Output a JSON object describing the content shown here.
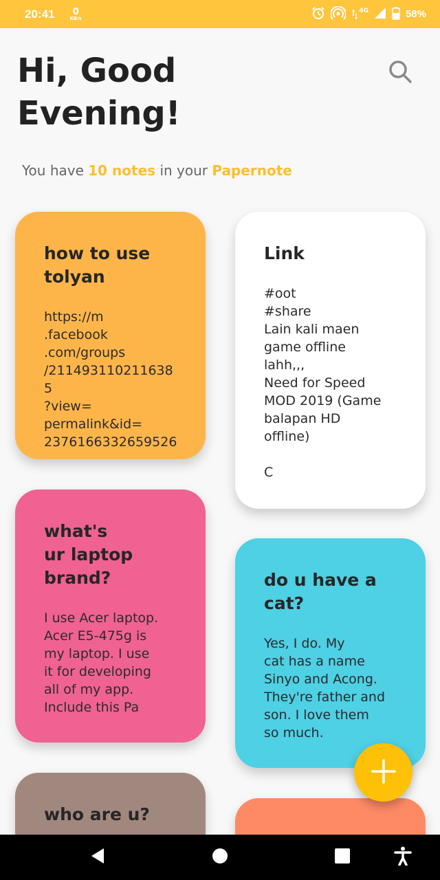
{
  "status_bar": {
    "time": "20:41",
    "net_speed_value": "0",
    "net_speed_unit": "KB/s",
    "network_type": "4G",
    "battery": "58%",
    "icons": [
      "alarm-icon",
      "hotspot-icon",
      "data-arrows-icon",
      "signal-icon",
      "battery-icon"
    ]
  },
  "header": {
    "greeting_line1": "Hi, Good",
    "greeting_line2": "Evening!",
    "search_icon": "search-icon"
  },
  "summary": {
    "prefix": "You have",
    "count": "10 notes",
    "middle": "in your",
    "app_name": "Papernote"
  },
  "notes": [
    {
      "title": "how to use\ntolyan",
      "body": "https://m\n.facebook\n.com/groups\n/211493110211638 5\n?view=\npermalink&id=\n2376166332659526",
      "color": "#fdb54a"
    },
    {
      "title": "Link",
      "body": "#oot\n#share\nLain kali maen\ngame offline\nlahh,,,\nNeed for Speed\nMOD 2019 (Game\nbalapan HD\noffline)\n\nC",
      "color": "#ffffff"
    },
    {
      "title": "what's\nur laptop\nbrand?",
      "body": "I use Acer laptop.\nAcer E5-475g is\nmy laptop. I use\nit for developing\nall of my app.\nInclude this Pa",
      "color": "#f06292"
    },
    {
      "title": "do u have a\ncat?",
      "body": "Yes, I do. My\ncat has a name\nSinyo and Acong.\nThey're father and\nson. I love them\nso much.",
      "color": "#4ed0e5"
    },
    {
      "title": "who are u?",
      "body": "",
      "color": "#a1887f"
    },
    {
      "title": "",
      "body": "",
      "color": "#fe8a65"
    }
  ],
  "fab_icon": "plus-icon",
  "nav_bar": {
    "icons": [
      "back-icon",
      "home-icon",
      "recents-icon",
      "accessibility-icon"
    ]
  },
  "colors": {
    "accent": "#fcbf30",
    "status_bar": "#fec53d",
    "fab": "#ffc107"
  }
}
